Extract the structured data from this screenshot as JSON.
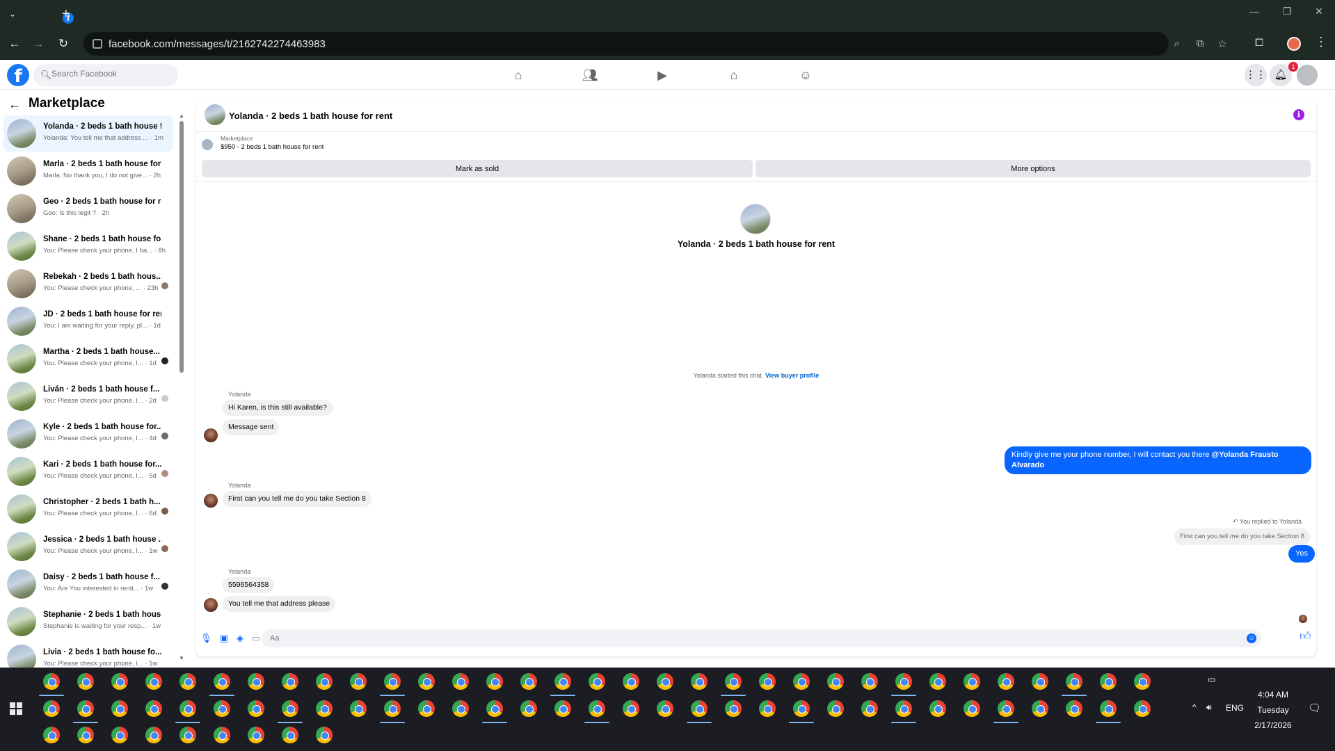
{
  "browser": {
    "url": "facebook.com/messages/t/2162742274463983",
    "favicon_letter": "f"
  },
  "fb_header": {
    "logo_letter": "f",
    "search_placeholder": "Search Facebook",
    "notification_count": "1"
  },
  "sidebar": {
    "title": "Marketplace",
    "conversations": [
      {
        "title": "Yolanda · 2 beds 1 bath house f...",
        "snippet": "Yolanda: You tell me that address ... · 1m"
      },
      {
        "title": "Marla · 2 beds 1 bath house for ...",
        "snippet": "Marla: No thank you, I do not give... · 2h"
      },
      {
        "title": "Geo · 2 beds 1 bath house for re...",
        "snippet": "Geo: Is this legit ? · 2h"
      },
      {
        "title": "Shane · 2 beds 1 bath house for...",
        "snippet": "You: Please check your phone, I ha... · 8h"
      },
      {
        "title": "Rebekah · 2 beds 1 bath hous...",
        "snippet": "You: Please check your phone, ... · 23h"
      },
      {
        "title": "JD · 2 beds 1 bath house for rent",
        "snippet": "You: I am waiting for your reply, pl... · 1d"
      },
      {
        "title": "Martha · 2 beds 1 bath house...",
        "snippet": "You: Please check your phone, I... · 1d"
      },
      {
        "title": "Liván · 2 beds 1 bath house f...",
        "snippet": "You: Please check your phone, I... · 2d"
      },
      {
        "title": "Kyle · 2 beds 1 bath house for...",
        "snippet": "You: Please check your phone, I... · 4d"
      },
      {
        "title": "Kari · 2 beds 1 bath house for...",
        "snippet": "You: Please check your phone, I... · 5d"
      },
      {
        "title": "Christopher · 2 beds 1 bath h...",
        "snippet": "You: Please check your phone, I... · 6d"
      },
      {
        "title": "Jessica · 2 beds 1 bath house ...",
        "snippet": "You: Please check your phone, I... · 1w"
      },
      {
        "title": "Daisy · 2 beds 1 bath house f...",
        "snippet": "You: Are You interested in renti... · 1w"
      },
      {
        "title": "Stephanie · 2 beds 1 bath house...",
        "snippet": "Stephanie is waiting for your resp... · 1w"
      },
      {
        "title": "Livia · 2 beds 1 bath house fo...",
        "snippet": "You: Please check your phone, I... · 1w"
      }
    ]
  },
  "chat": {
    "title": "Yolanda · 2 beds 1 bath house for rent",
    "listing_label": "Marketplace",
    "listing_title": "$950 - 2 beds 1 bath house for rent",
    "mark_sold_label": "Mark as sold",
    "more_options_label": "More options",
    "intro_title": "Yolanda · 2 beds 1 bath house for rent",
    "system_text": "Yolanda started this chat.",
    "system_link": "View buyer profile",
    "sender": "Yolanda",
    "msg1": "Hi Karen, is this still available?",
    "msg2": "Message sent",
    "out1_text": "Kindly give me your phone number, I will contact you there ",
    "out1_mention": "@Yolanda Frausto Alvarado",
    "msg3": "First can you tell me do you take Section 8",
    "reply_note": "You replied to Yolanda",
    "reply_quote": "First can you tell me do you take Section 8",
    "out2": "Yes",
    "msg4": "5596564358",
    "msg5": "You tell me that address please",
    "composer_placeholder": "Aa"
  },
  "taskbar": {
    "time": "4:04 AM",
    "day": "Tuesday",
    "date": "2/17/2026",
    "lang": "ENG"
  }
}
